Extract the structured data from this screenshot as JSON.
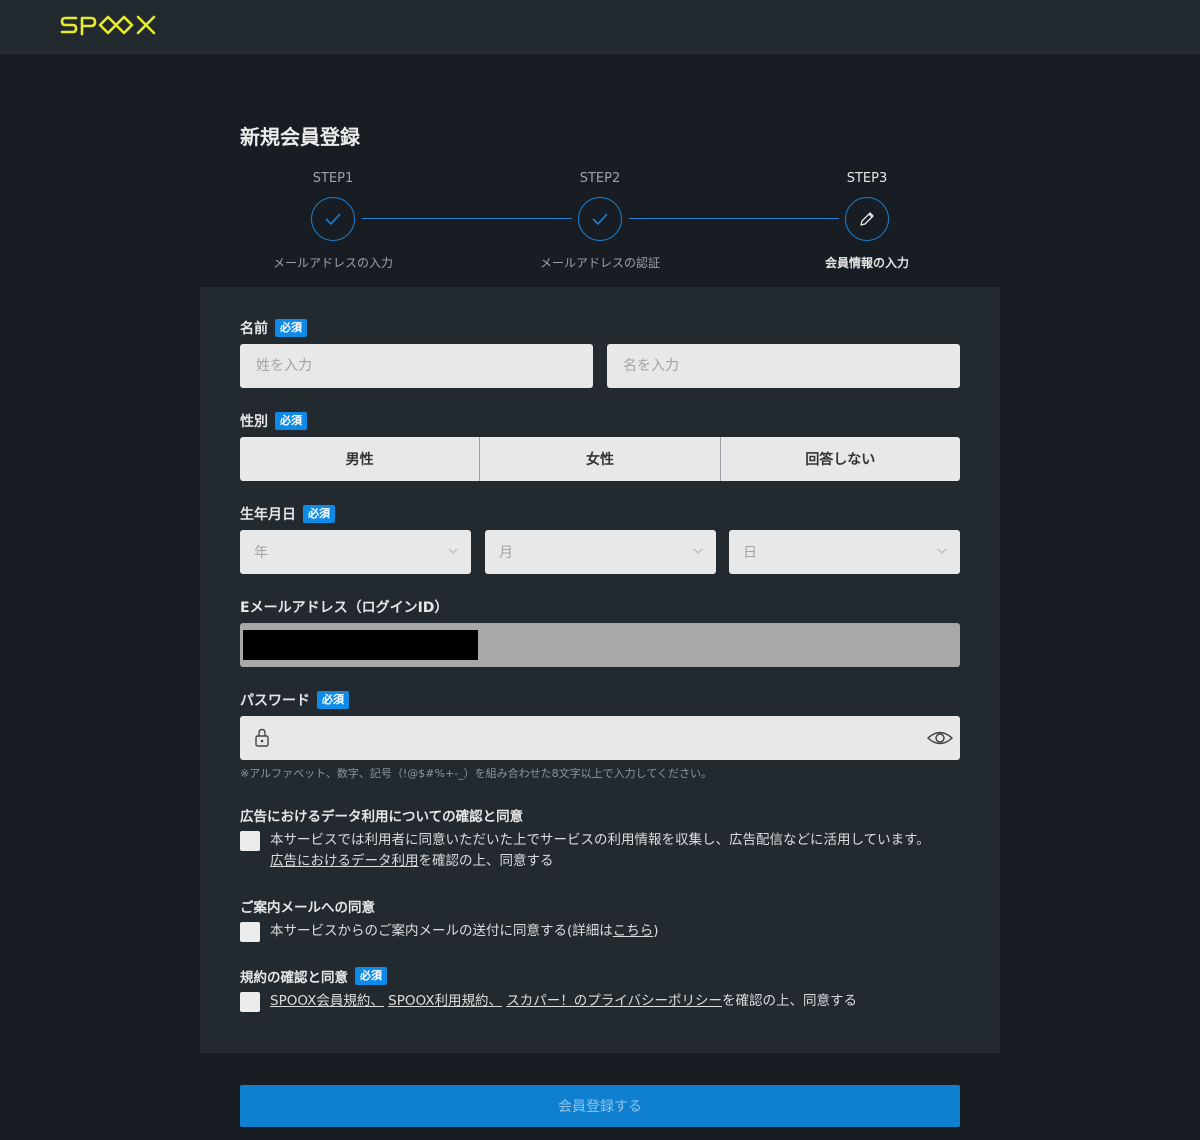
{
  "header": {
    "logo": "SPOOX"
  },
  "page_title": "新規会員登録",
  "steps": [
    {
      "label": "STEP1",
      "name": "メールアドレスの入力",
      "state": "done"
    },
    {
      "label": "STEP2",
      "name": "メールアドレスの認証",
      "state": "done"
    },
    {
      "label": "STEP3",
      "name": "会員情報の入力",
      "state": "current"
    }
  ],
  "required_badge": "必須",
  "form": {
    "name": {
      "label": "名前",
      "last_placeholder": "姓を入力",
      "first_placeholder": "名を入力"
    },
    "gender": {
      "label": "性別",
      "options": [
        "男性",
        "女性",
        "回答しない"
      ]
    },
    "birthdate": {
      "label": "生年月日",
      "year_placeholder": "年",
      "month_placeholder": "月",
      "day_placeholder": "日"
    },
    "email": {
      "label": "Eメールアドレス（ログインID）",
      "value_redacted": true
    },
    "password": {
      "label": "パスワード",
      "hint": "※アルファベット、数字、記号（!@$#%+-_）を組み合わせた8文字以上で入力してください。"
    }
  },
  "consents": {
    "ad_data": {
      "title": "広告におけるデータ利用についての確認と同意",
      "text_line1": "本サービスでは利用者に同意いただいた上でサービスの利用情報を収集し、広告配信などに活用しています。",
      "link": "広告におけるデータ利用",
      "text_line2_suffix": "を確認の上、同意する",
      "checked": false
    },
    "mail": {
      "title": "ご案内メールへの同意",
      "text_prefix": "本サービスからのご案内メールの送付に同意する(詳細は",
      "link": "こちら",
      "text_suffix": ")",
      "checked": false
    },
    "terms": {
      "title": "規約の確認と同意",
      "link1": "SPOOX会員規約、",
      "link2": "SPOOX利用規約、",
      "link3": "スカパー！のプライバシーポリシー",
      "text_suffix": "を確認の上、同意する",
      "checked": false
    }
  },
  "submit_label": "会員登録する",
  "colors": {
    "background": "#171d22",
    "card": "#222a30",
    "accent": "#0f8ae6",
    "logo_yellow": "#e5ec2c",
    "input": "#e8e8e8"
  }
}
